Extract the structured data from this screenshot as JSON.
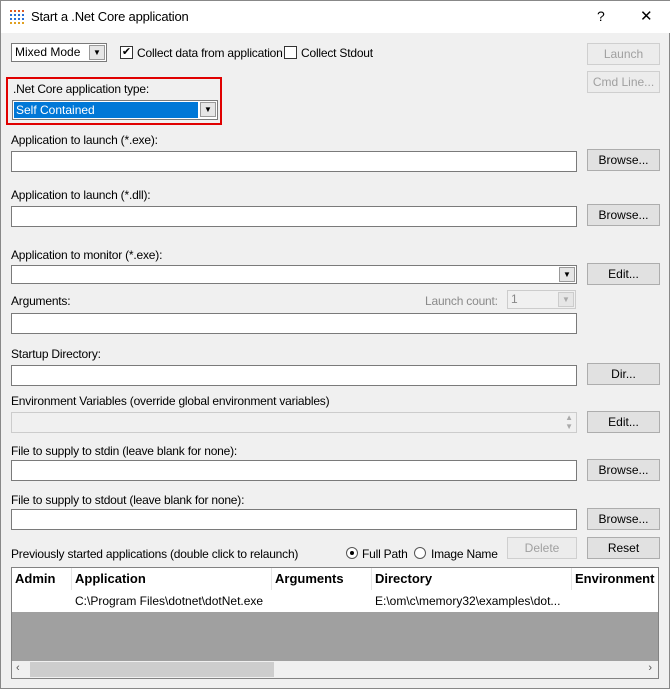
{
  "window": {
    "title": "Start a .Net Core application",
    "help": "?",
    "close": "✕"
  },
  "top": {
    "mode": "Mixed Mode",
    "collect_data": "Collect data from application",
    "collect_data_checked": true,
    "collect_stdout": "Collect Stdout",
    "collect_stdout_checked": false,
    "launch": "Launch",
    "cmd_line": "Cmd Line..."
  },
  "app_type": {
    "label": ".Net Core application type:",
    "value": "Self Contained"
  },
  "fields": {
    "exe_label": "Application to launch (*.exe):",
    "exe_value": "",
    "browse": "Browse...",
    "dll_label": "Application to launch (*.dll):",
    "dll_value": "",
    "monitor_label": "Application to monitor (*.exe):",
    "monitor_value": "",
    "edit": "Edit...",
    "args_label": "Arguments:",
    "args_value": "",
    "launch_count_label": "Launch count:",
    "launch_count": "1",
    "dir_label": "Startup Directory:",
    "dir_value": "",
    "dir_button": "Dir...",
    "env_label": "Environment Variables (override global environment variables)",
    "stdin_label": "File to supply to stdin (leave blank for none):",
    "stdout_label": "File to supply to stdout (leave blank for none):"
  },
  "history": {
    "label": "Previously started applications (double click to relaunch)",
    "full_path": "Full Path",
    "image_name": "Image Name",
    "selected": "Full Path",
    "delete": "Delete",
    "reset": "Reset",
    "columns": [
      "Admin",
      "Application",
      "Arguments",
      "Directory",
      "Environment"
    ],
    "rows": [
      [
        "",
        "C:\\Program Files\\dotnet\\dotNet.exe",
        "",
        "E:\\om\\c\\memory32\\examples\\dot...",
        ""
      ]
    ]
  }
}
